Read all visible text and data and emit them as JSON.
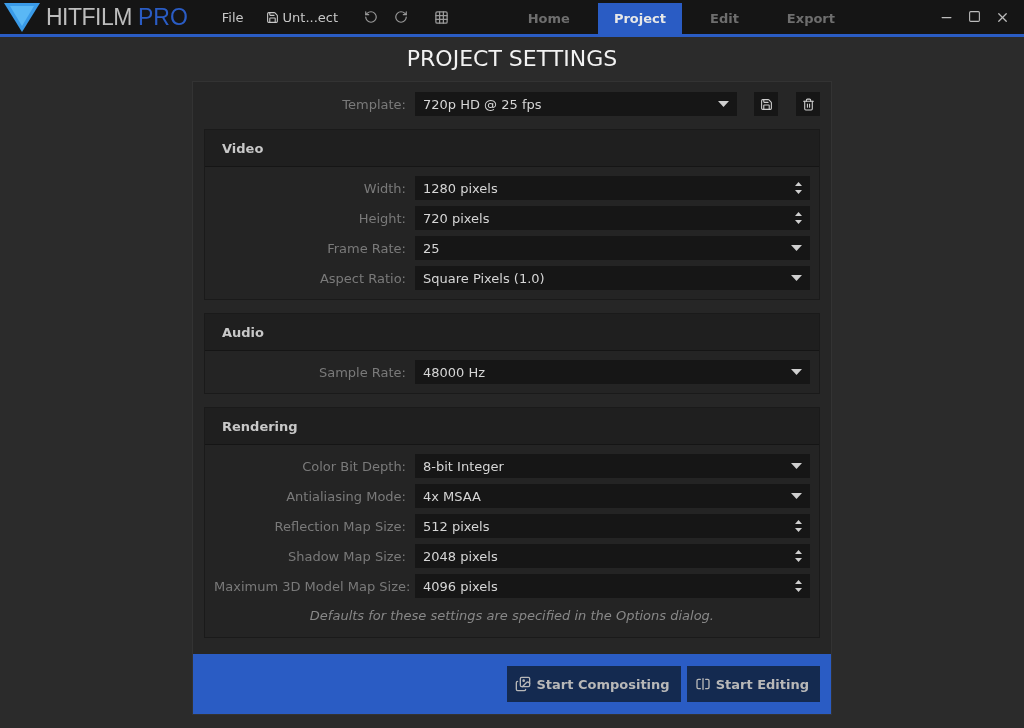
{
  "app": {
    "brand": "HITFILM",
    "edition": "PRO"
  },
  "menu": {
    "file": "File",
    "project_name": "Unt...ect"
  },
  "tabs": [
    {
      "label": "Home",
      "selected": false
    },
    {
      "label": "Project",
      "selected": true
    },
    {
      "label": "Edit",
      "selected": false
    },
    {
      "label": "Export",
      "selected": false
    }
  ],
  "title": "PROJECT SETTINGS",
  "template": {
    "label": "Template:",
    "value": "720p HD @ 25 fps"
  },
  "sections": [
    {
      "title": "Video",
      "rows": [
        {
          "label": "Width:",
          "value": "1280 pixels",
          "kind": "spin"
        },
        {
          "label": "Height:",
          "value": "720 pixels",
          "kind": "spin"
        },
        {
          "label": "Frame Rate:",
          "value": "25",
          "kind": "dropdown"
        },
        {
          "label": "Aspect Ratio:",
          "value": "Square Pixels (1.0)",
          "kind": "dropdown"
        }
      ]
    },
    {
      "title": "Audio",
      "rows": [
        {
          "label": "Sample Rate:",
          "value": "48000 Hz",
          "kind": "dropdown"
        }
      ]
    },
    {
      "title": "Rendering",
      "rows": [
        {
          "label": "Color Bit Depth:",
          "value": "8-bit Integer",
          "kind": "dropdown"
        },
        {
          "label": "Antialiasing Mode:",
          "value": "4x MSAA",
          "kind": "dropdown"
        },
        {
          "label": "Reflection Map Size:",
          "value": "512 pixels",
          "kind": "spin"
        },
        {
          "label": "Shadow Map Size:",
          "value": "2048 pixels",
          "kind": "spin"
        },
        {
          "label": "Maximum 3D Model Map Size:",
          "value": "4096 pixels",
          "kind": "spin"
        }
      ],
      "note": "Defaults for these settings are specified in the Options dialog."
    }
  ],
  "buttons": [
    {
      "label": "Start Compositing",
      "kind": "compositing"
    },
    {
      "label": "Start Editing",
      "kind": "editing"
    }
  ]
}
